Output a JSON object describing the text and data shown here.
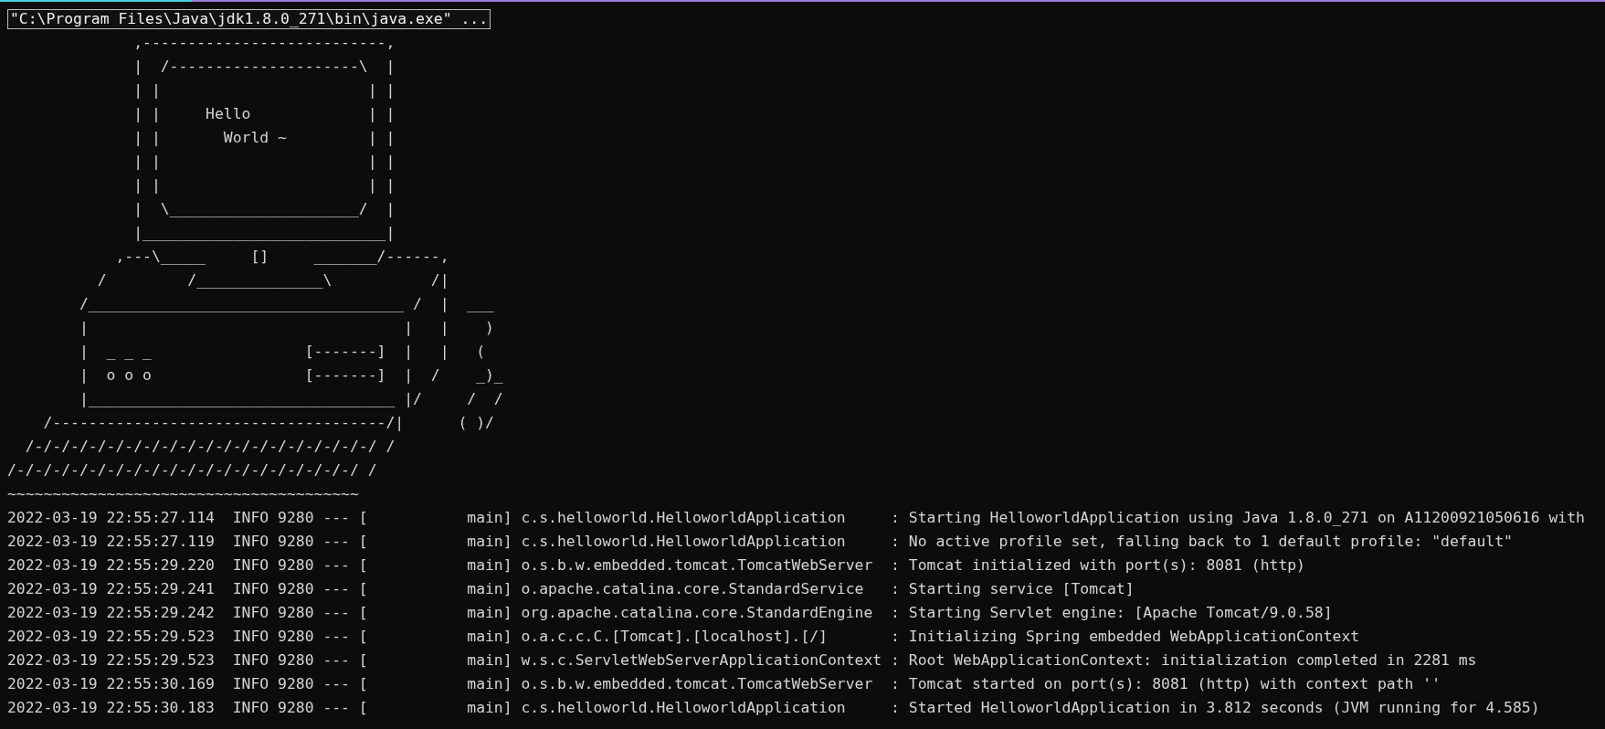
{
  "window": {
    "title": "\"C:\\Program Files\\Java\\jdk1.8.0_271\\bin\\java.exe\" ..."
  },
  "banner": [
    "              ,---------------------------,",
    "              |  /---------------------\\  |",
    "              | |                       | |",
    "              | |     Hello             | |",
    "              | |       World ~         | |",
    "              | |                       | |",
    "              | |                       | |",
    "              |  \\_____________________/  |",
    "              |___________________________|",
    "            ,---\\_____     []     _______/------,",
    "          /         /______________\\           /|",
    "        /___________________________________ /  |  ___",
    "        |                                   |   |    )",
    "        |  _ _ _                 [-------]  |   |   (",
    "        |  o o o                 [-------]  |  /    _)_",
    "        |__________________________________ |/     /  /",
    "    /-------------------------------------/|      ( )/",
    "  /-/-/-/-/-/-/-/-/-/-/-/-/-/-/-/-/-/-/-/ /",
    "/-/-/-/-/-/-/-/-/-/-/-/-/-/-/-/-/-/-/-/ /"
  ],
  "banner_rule": "~~~~~~~~~~~~~~~~~~~~~~~~~~~~~~~~~~~~~~~",
  "log": [
    "2022-03-19 22:55:27.114  INFO 9280 --- [           main] c.s.helloworld.HelloworldApplication     : Starting HelloworldApplication using Java 1.8.0_271 on A11200921050616 with",
    "2022-03-19 22:55:27.119  INFO 9280 --- [           main] c.s.helloworld.HelloworldApplication     : No active profile set, falling back to 1 default profile: \"default\"",
    "2022-03-19 22:55:29.220  INFO 9280 --- [           main] o.s.b.w.embedded.tomcat.TomcatWebServer  : Tomcat initialized with port(s): 8081 (http)",
    "2022-03-19 22:55:29.241  INFO 9280 --- [           main] o.apache.catalina.core.StandardService   : Starting service [Tomcat]",
    "2022-03-19 22:55:29.242  INFO 9280 --- [           main] org.apache.catalina.core.StandardEngine  : Starting Servlet engine: [Apache Tomcat/9.0.58]",
    "2022-03-19 22:55:29.523  INFO 9280 --- [           main] o.a.c.c.C.[Tomcat].[localhost].[/]       : Initializing Spring embedded WebApplicationContext",
    "2022-03-19 22:55:29.523  INFO 9280 --- [           main] w.s.c.ServletWebServerApplicationContext : Root WebApplicationContext: initialization completed in 2281 ms",
    "2022-03-19 22:55:30.169  INFO 9280 --- [           main] o.s.b.w.embedded.tomcat.TomcatWebServer  : Tomcat started on port(s): 8081 (http) with context path ''",
    "2022-03-19 22:55:30.183  INFO 9280 --- [           main] c.s.helloworld.HelloworldApplication     : Started HelloworldApplication in 3.812 seconds (JVM running for 4.585)"
  ]
}
